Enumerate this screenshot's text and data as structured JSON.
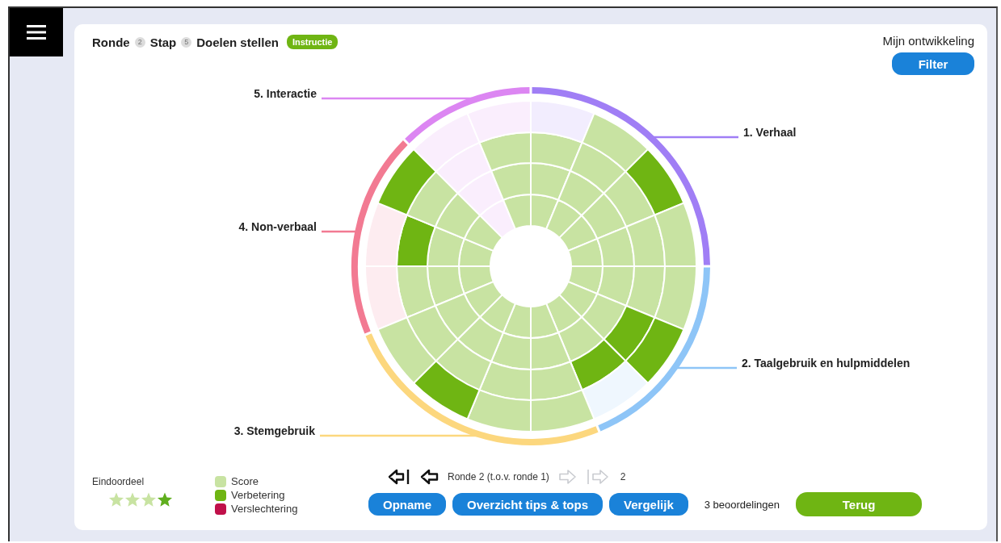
{
  "header": {
    "round_label": "Ronde",
    "round": "2",
    "step_label": "Stap",
    "step": "5",
    "title": "Doelen stellen",
    "instruction_button": "Instructie"
  },
  "development": {
    "title": "Mijn ontwikkeling",
    "filter_button": "Filter"
  },
  "wheel": {
    "categories": [
      {
        "name": "5. Interactie",
        "color": "#dc86f2",
        "segments": [
          {
            "cells": [
              {
                "kind": "empty"
              },
              {
                "kind": "empty"
              },
              {
                "kind": "empty"
              },
              {
                "kind": "empty"
              }
            ]
          },
          {
            "cells": [
              {
                "kind": "score"
              },
              {
                "kind": "score"
              },
              {
                "kind": "score"
              },
              {
                "kind": "empty"
              }
            ]
          }
        ]
      },
      {
        "name": "1. Verhaal",
        "color": "#a07ef5",
        "segments": [
          {
            "cells": [
              {
                "kind": "score"
              },
              {
                "kind": "score"
              },
              {
                "kind": "score"
              },
              {
                "kind": "empty"
              }
            ]
          },
          {
            "cells": [
              {
                "kind": "score"
              },
              {
                "kind": "score"
              },
              {
                "kind": "score"
              },
              {
                "kind": "score"
              }
            ]
          },
          {
            "cells": [
              {
                "kind": "score"
              },
              {
                "kind": "score"
              },
              {
                "kind": "score"
              },
              {
                "kind": "improvement"
              }
            ]
          },
          {
            "cells": [
              {
                "kind": "score"
              },
              {
                "kind": "score"
              },
              {
                "kind": "score"
              },
              {
                "kind": "score"
              }
            ]
          }
        ]
      },
      {
        "name": "4. Non-verbaal",
        "color": "#f27a92",
        "segments": [
          {
            "cells": [
              {
                "kind": "score"
              },
              {
                "kind": "score"
              },
              {
                "kind": "score"
              },
              {
                "kind": "empty"
              }
            ]
          },
          {
            "cells": [
              {
                "kind": "score"
              },
              {
                "kind": "score"
              },
              {
                "kind": "improvement"
              },
              {
                "kind": "empty"
              }
            ]
          },
          {
            "cells": [
              {
                "kind": "score"
              },
              {
                "kind": "score"
              },
              {
                "kind": "score"
              },
              {
                "kind": "improvement"
              }
            ]
          }
        ]
      },
      {
        "name": "2. Taalgebruik en hulpmiddelen",
        "color": "#8ec5f7",
        "segments": [
          {
            "cells": [
              {
                "kind": "score"
              },
              {
                "kind": "score"
              },
              {
                "kind": "score"
              },
              {
                "kind": "score"
              }
            ]
          },
          {
            "cells": [
              {
                "kind": "score"
              },
              {
                "kind": "score"
              },
              {
                "kind": "improvement"
              },
              {
                "kind": "improvement"
              }
            ]
          },
          {
            "cells": [
              {
                "kind": "score"
              },
              {
                "kind": "score"
              },
              {
                "kind": "improvement"
              },
              {
                "kind": "empty"
              }
            ]
          }
        ]
      },
      {
        "name": "3. Stemgebruik",
        "color": "#fcd77e",
        "segments": [
          {
            "cells": [
              {
                "kind": "score"
              },
              {
                "kind": "score"
              },
              {
                "kind": "score"
              },
              {
                "kind": "score"
              }
            ]
          },
          {
            "cells": [
              {
                "kind": "score"
              },
              {
                "kind": "score"
              },
              {
                "kind": "score"
              },
              {
                "kind": "score"
              }
            ]
          },
          {
            "cells": [
              {
                "kind": "score"
              },
              {
                "kind": "score"
              },
              {
                "kind": "score"
              },
              {
                "kind": "improvement"
              }
            ]
          },
          {
            "cells": [
              {
                "kind": "score"
              },
              {
                "kind": "score"
              },
              {
                "kind": "score"
              },
              {
                "kind": "score"
              }
            ]
          }
        ]
      }
    ]
  },
  "final": {
    "label": "Eindoordeel",
    "stars": 1
  },
  "legend": [
    {
      "label": "Score",
      "color": "#c8e3a2"
    },
    {
      "label": "Verbetering",
      "color": "#6fb513"
    },
    {
      "label": "Verslechtering",
      "color": "#c0104a"
    }
  ],
  "nav": [
    {
      "kind": "first",
      "disabled": false
    },
    {
      "kind": "previous",
      "disabled": false
    },
    {
      "kind": "label",
      "text": "Ronde 2 (t.o.v. ronde 1)"
    },
    {
      "kind": "next",
      "disabled": true
    },
    {
      "kind": "last",
      "disabled": true
    },
    {
      "kind": "count",
      "text": "2"
    }
  ],
  "buttons": [
    "Opname",
    "Overzicht tips & tops",
    "Vergelijk"
  ],
  "ratings": "3 beoordelingen",
  "back_button": "Terug"
}
